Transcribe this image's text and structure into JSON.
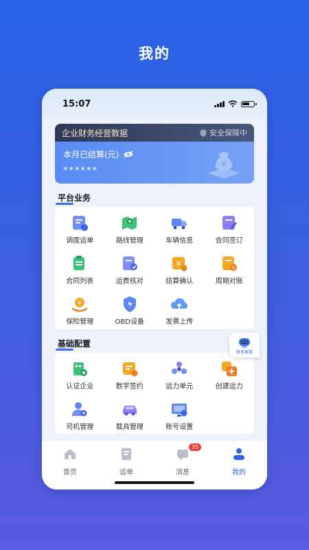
{
  "page": {
    "heading": "我的"
  },
  "status_bar": {
    "time": "15:07"
  },
  "finance_card": {
    "title": "企业财务经营数据",
    "safe_label": "安全保障中",
    "settled_label": "本月已结算(元)",
    "masked_value": "******"
  },
  "platform": {
    "title": "平台业务",
    "items": [
      {
        "label": "调度运单",
        "icon": "dispatch-order-icon"
      },
      {
        "label": "路线管理",
        "icon": "route-map-icon"
      },
      {
        "label": "车辆信息",
        "icon": "truck-icon"
      },
      {
        "label": "合同签订",
        "icon": "contract-sign-icon"
      },
      {
        "label": "合同列表",
        "icon": "contract-list-icon"
      },
      {
        "label": "运费核对",
        "icon": "freight-check-icon"
      },
      {
        "label": "结算确认",
        "icon": "settlement-icon"
      },
      {
        "label": "周期对账",
        "icon": "period-reconcile-icon"
      },
      {
        "label": "保险管理",
        "icon": "insurance-icon"
      },
      {
        "label": "OBD设备",
        "icon": "obd-device-icon"
      },
      {
        "label": "发票上传",
        "icon": "cloud-upload-icon"
      }
    ]
  },
  "basic": {
    "title": "基础配置",
    "items": [
      {
        "label": "认证企业",
        "icon": "company-auth-icon"
      },
      {
        "label": "数字签约",
        "icon": "digital-sign-icon"
      },
      {
        "label": "运力单元",
        "icon": "capacity-unit-icon"
      },
      {
        "label": "创建运力",
        "icon": "create-capacity-icon"
      },
      {
        "label": "司机管理",
        "icon": "driver-icon"
      },
      {
        "label": "载具管理",
        "icon": "vehicle-icon"
      },
      {
        "label": "账号设置",
        "icon": "account-settings-icon"
      }
    ]
  },
  "support": {
    "label": "联系客服"
  },
  "tabbar": {
    "tabs": [
      {
        "label": "首页",
        "icon": "home-icon"
      },
      {
        "label": "运单",
        "icon": "waybill-icon"
      },
      {
        "label": "消息",
        "icon": "message-icon",
        "badge": "35"
      },
      {
        "label": "我的",
        "icon": "profile-icon",
        "active": true
      }
    ]
  },
  "colors": {
    "accent": "#2f64e8",
    "badge": "#ef3b3b"
  }
}
